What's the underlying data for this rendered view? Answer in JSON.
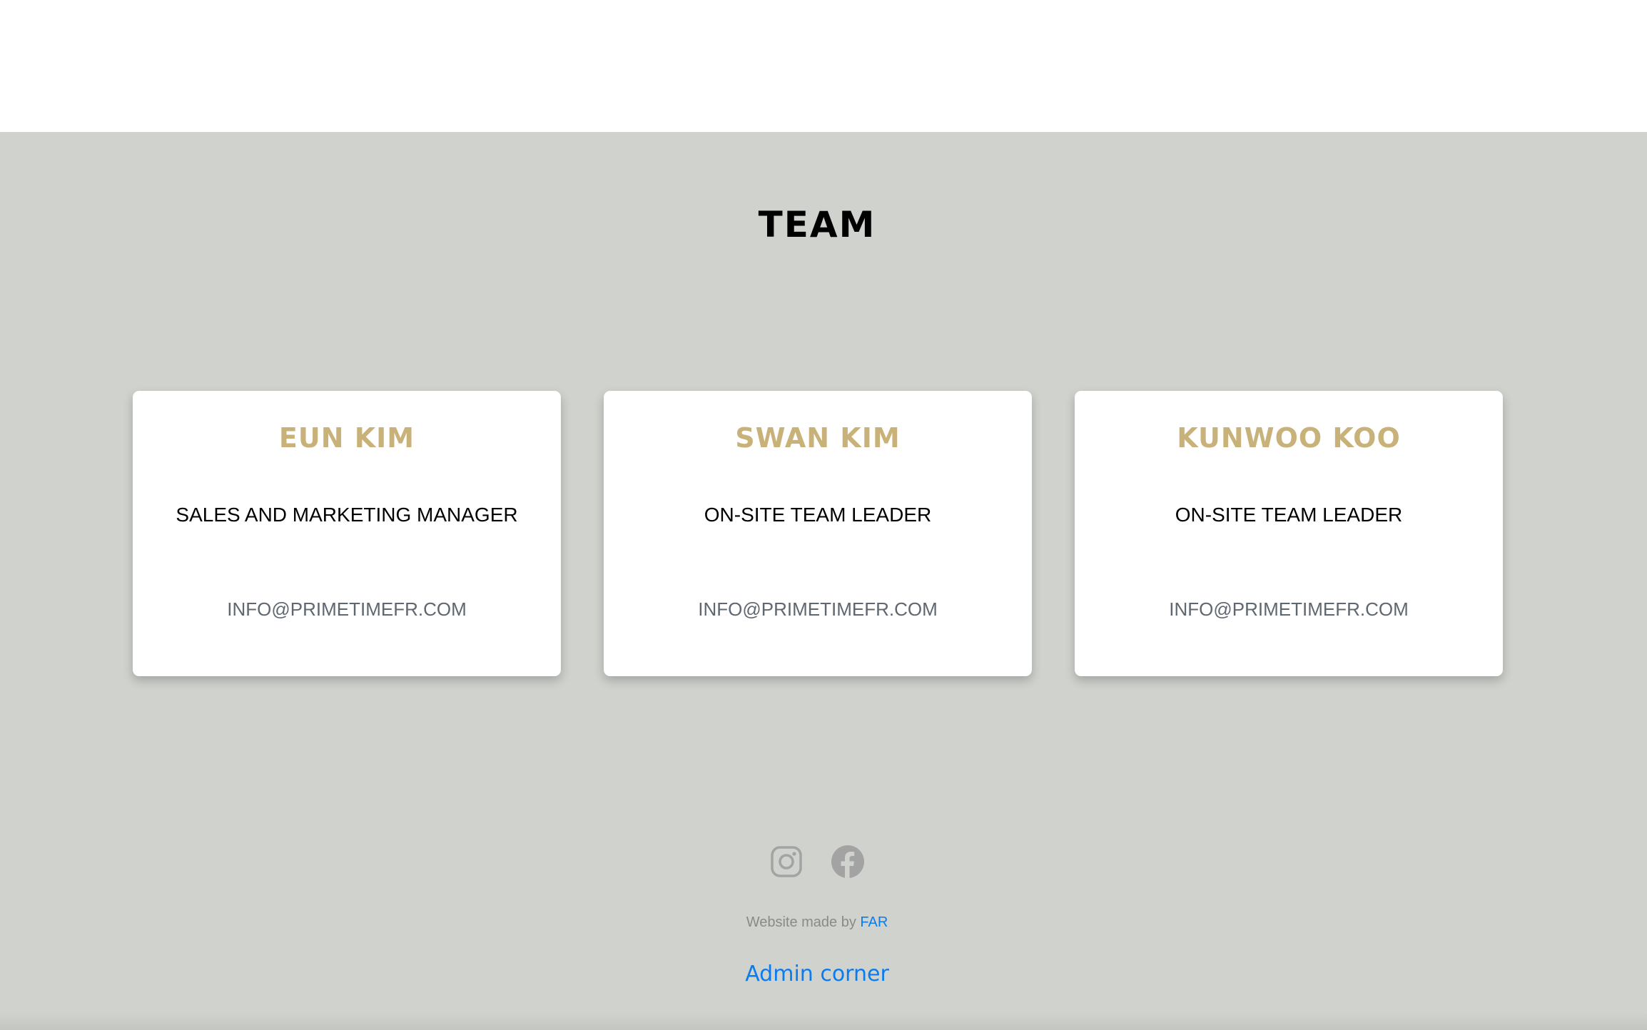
{
  "section": {
    "title": "TEAM"
  },
  "team": [
    {
      "name": "EUN KIM",
      "role": "SALES AND MARKETING MANAGER",
      "email": "INFO@PRIMETIMEFR.COM"
    },
    {
      "name": "SWAN KIM",
      "role": "ON-SITE TEAM LEADER",
      "email": "INFO@PRIMETIMEFR.COM"
    },
    {
      "name": "KUNWOO KOO",
      "role": "ON-SITE TEAM LEADER",
      "email": "INFO@PRIMETIMEFR.COM"
    }
  ],
  "footer": {
    "social_icons": [
      "instagram-icon",
      "facebook-icon"
    ],
    "credit_prefix": "Website made by ",
    "credit_link": "FAR",
    "admin_link": "Admin corner"
  },
  "colors": {
    "background": "#d0d2ce",
    "card": "#ffffff",
    "name_gold": "#c8b27a",
    "link_blue": "#0a7cf0",
    "icon_gray": "#a3a3a3"
  }
}
